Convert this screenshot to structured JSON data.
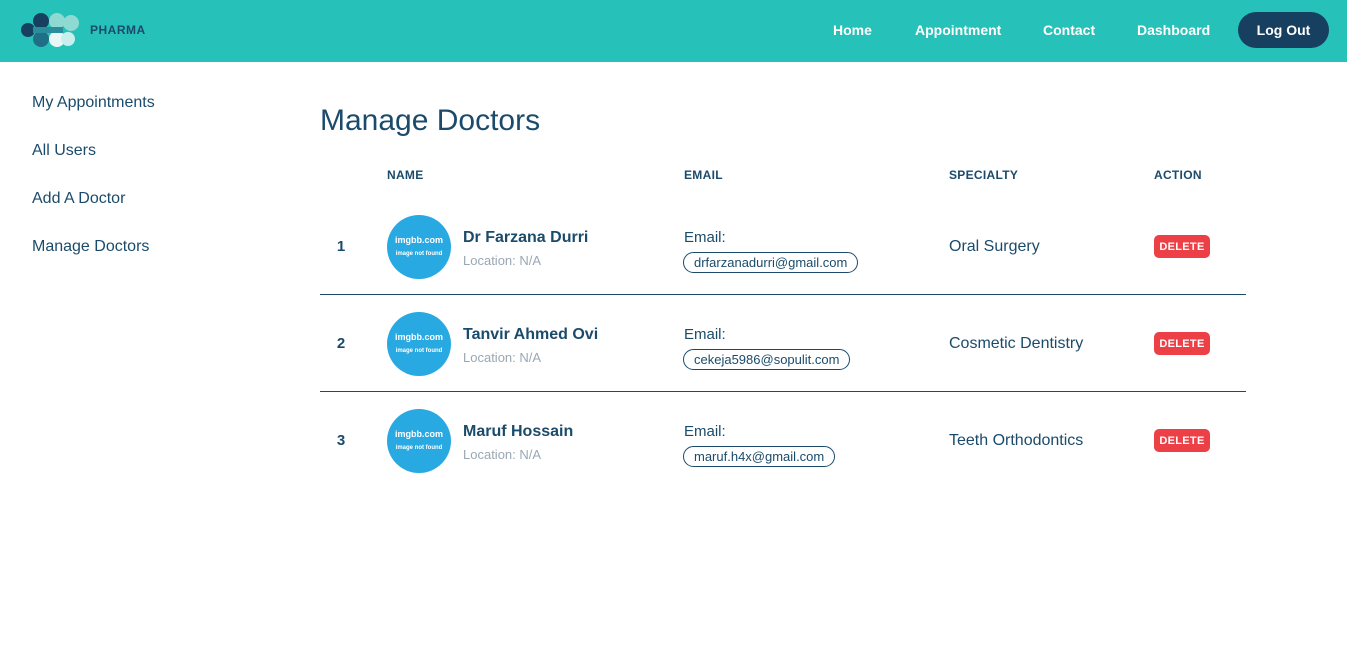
{
  "brand": {
    "logo_text": "PHARMA",
    "logo_icon": "pharma-molecule-logo",
    "colors": {
      "header": "#26c1b8",
      "dark": "#173f5f",
      "text": "#1b4b6b",
      "danger": "#ec3f46",
      "avatar": "#29a9e2"
    }
  },
  "nav": {
    "home": "Home",
    "appointment": "Appointment",
    "contact": "Contact",
    "dashboard": "Dashboard",
    "logout": "Log Out"
  },
  "sidebar": {
    "items": [
      {
        "label": "My Appointments"
      },
      {
        "label": "All Users"
      },
      {
        "label": "Add A Doctor"
      },
      {
        "label": "Manage Doctors"
      }
    ]
  },
  "main": {
    "title": "Manage Doctors",
    "columns": {
      "name": "NAME",
      "email": "EMAIL",
      "specialty": "SPECIALTY",
      "action": "ACTION"
    },
    "rows": [
      {
        "num": "1",
        "avatar_line1": "imgbb.com",
        "avatar_line2": "image not found",
        "name": "Dr Farzana Durri",
        "location": "Location: N/A",
        "email_label": "Email:",
        "email": "drfarzanadurri@gmail.com",
        "specialty": "Oral Surgery",
        "action": "DELETE"
      },
      {
        "num": "2",
        "avatar_line1": "imgbb.com",
        "avatar_line2": "image not found",
        "name": "Tanvir Ahmed Ovi",
        "location": "Location: N/A",
        "email_label": "Email:",
        "email": "cekeja5986@sopulit.com",
        "specialty": "Cosmetic Dentistry",
        "action": "DELETE"
      },
      {
        "num": "3",
        "avatar_line1": "imgbb.com",
        "avatar_line2": "image not found",
        "name": "Maruf Hossain",
        "location": "Location: N/A",
        "email_label": "Email:",
        "email": "maruf.h4x@gmail.com",
        "specialty": "Teeth Orthodontics",
        "action": "DELETE"
      }
    ]
  }
}
